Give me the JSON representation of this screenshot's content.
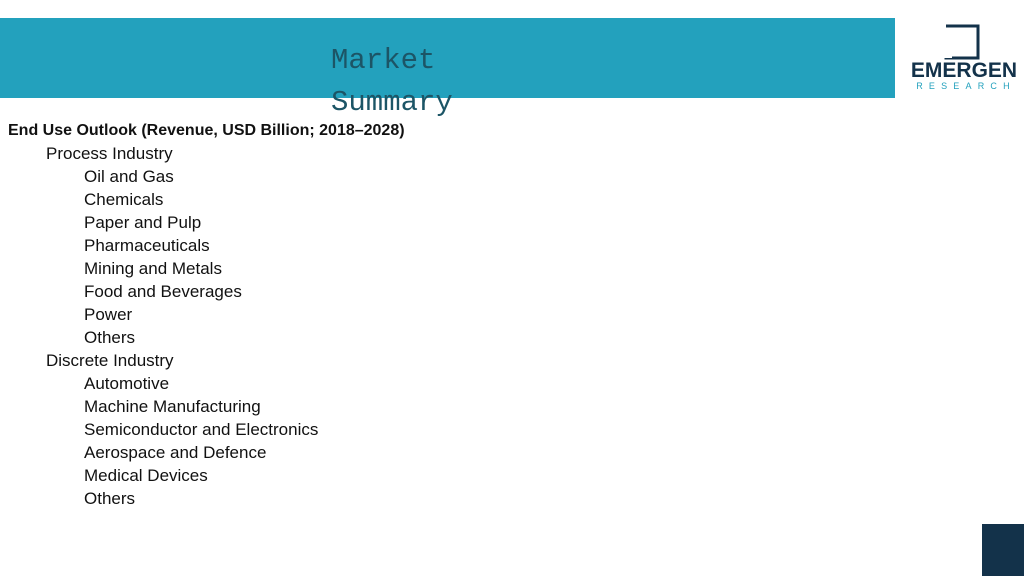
{
  "header": {
    "title": "Market\nSummary"
  },
  "logo": {
    "name": "EMERGEN",
    "sub": "RESEARCH",
    "mark_icon": "square-bracket-logo-icon"
  },
  "outline": {
    "heading": "End Use Outlook (Revenue, USD Billion; 2018–2028)",
    "groups": [
      {
        "label": "Process Industry",
        "items": [
          "Oil and Gas",
          "Chemicals",
          "Paper and Pulp",
          "Pharmaceuticals",
          "Mining and Metals",
          "Food and Beverages",
          "Power",
          "Others"
        ]
      },
      {
        "label": "Discrete Industry",
        "items": [
          "Automotive",
          "Machine Manufacturing",
          "Semiconductor and Electronics",
          "Aerospace and Defence",
          "Medical Devices",
          "Others"
        ]
      }
    ]
  },
  "colors": {
    "banner": "#23a1bd",
    "title": "#1c5566",
    "navy": "#13324a"
  }
}
